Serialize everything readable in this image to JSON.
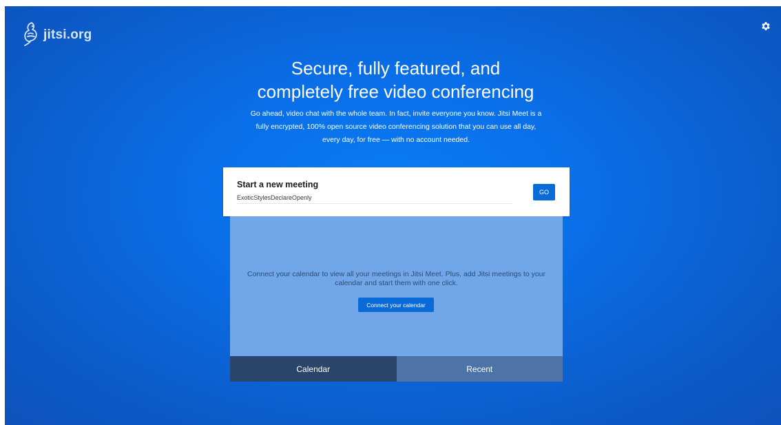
{
  "logo": {
    "text": "jitsi.org",
    "icon": "jitsi-logo-icon"
  },
  "settings": {
    "icon": "gear-icon"
  },
  "headline": {
    "line1": "Secure, fully featured, and",
    "line2": "completely free video conferencing"
  },
  "description": {
    "line1": "Go ahead, video chat with the whole team. In fact, invite everyone you know. Jitsi Meet is a",
    "line2": "fully encrypted, 100% open source video conferencing solution that you can use all day,",
    "line3": "every day, for free — with no account needed."
  },
  "start_meeting": {
    "label": "Start a new meeting",
    "room_name": "ExoticStylesDeclareOpenly",
    "go_label": "GO"
  },
  "calendar": {
    "line1": "Connect your calendar to view all your meetings in Jitsi Meet. Plus, add Jitsi meetings to your",
    "line2": "calendar and start them with one click.",
    "connect_label": "Connect your calendar"
  },
  "tabs": [
    {
      "label": "Calendar",
      "selected": true
    },
    {
      "label": "Recent",
      "selected": false
    }
  ],
  "colors": {
    "background": "#0a6fe8",
    "accent_button": "#0a6ad8",
    "calendar_panel": "#71a6e8",
    "tab_selected": "#2a4569",
    "tab_unselected": "#4d73a7"
  }
}
